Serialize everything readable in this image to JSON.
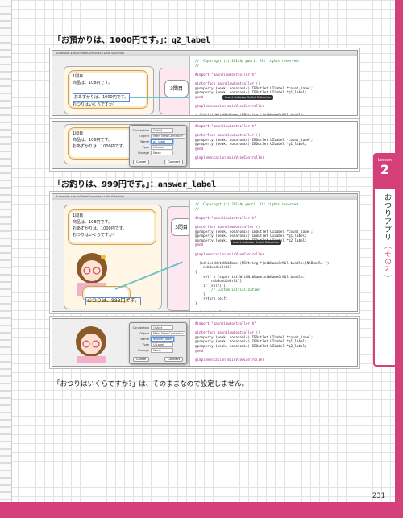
{
  "page": {
    "number": "231"
  },
  "headings": [
    {
      "prefix": "「お預かりは、1000円です。」：",
      "code": "q2_label"
    },
    {
      "prefix": "「お釣りは、999円です。」：",
      "code": "answer_label"
    }
  ],
  "caption": "「おつりはいくらですか?」は、そのままなので設定しません。",
  "side_tab": {
    "lesson": "Lesson",
    "number": "2",
    "title": "おつりアプリ",
    "subtitle": "（その2）"
  },
  "screens": {
    "toolbar_text": "Automatic  ▸  mainViewController.h  ▸  No Selection",
    "connection_badge": "Insert Outlet or Outlet Collection",
    "shot1": {
      "bubble_lines": [
        "1問目",
        "商品は、108円です。",
        "おあずかりは、1000円です。",
        "おつりはいくらですか?"
      ],
      "right_label": "3問目",
      "code": [
        {
          "t": "//  Copyright (c) 2014年 ymori. All rights reserved.",
          "c": "comment"
        },
        {
          "t": "//",
          "c": "comment"
        },
        {
          "t": "",
          "c": ""
        },
        {
          "t": "#import \"mainViewController.h\"",
          "c": "kw"
        },
        {
          "t": "",
          "c": ""
        },
        {
          "t": "@interface mainViewController ()",
          "c": "kw"
        },
        {
          "t": "@property (weak, nonatomic) IBOutlet UILabel *count_label;",
          "c": ""
        },
        {
          "t": "@property (weak, nonatomic) IBOutlet UILabel *q1_label;",
          "c": ""
        },
        {
          "t": "@end",
          "c": "kw"
        },
        {
          "t": "",
          "c": ""
        },
        {
          "t": "@implementation mainViewController",
          "c": "kw"
        },
        {
          "t": "",
          "c": ""
        },
        {
          "t": "- (id)initWithNibName:(NSString *)nibNameOrNil bundle:",
          "c": ""
        }
      ]
    },
    "dialog1": {
      "rows": [
        {
          "k": "Connection",
          "v": "Outlet"
        },
        {
          "k": "Object",
          "v": "Main View Controller"
        },
        {
          "k": "Name",
          "v": "q2_label"
        },
        {
          "k": "Type",
          "v": "UILabel"
        },
        {
          "k": "Storage",
          "v": "Weak"
        }
      ],
      "cancel": "Cancel",
      "connect": "Connect"
    },
    "shot2": {
      "bubble_lines": [
        "1問目",
        "商品は、108円です。",
        "おあずかりは、1000円です。"
      ],
      "code": [
        {
          "t": "#import \"mainViewController.h\"",
          "c": "kw"
        },
        {
          "t": "",
          "c": ""
        },
        {
          "t": "@interface mainViewController ()",
          "c": "kw"
        },
        {
          "t": "@property (weak, nonatomic) IBOutlet UILabel *count_label;",
          "c": ""
        },
        {
          "t": "@property (weak, nonatomic) IBOutlet UILabel *q1_label;",
          "c": ""
        },
        {
          "t": "@end",
          "c": "kw"
        },
        {
          "t": "",
          "c": ""
        },
        {
          "t": "@implementation mainViewController",
          "c": "kw"
        }
      ]
    },
    "shot3": {
      "bubble_lines": [
        "1問目",
        "商品は、108円です。",
        "おあずかりは、1000円です。",
        "おつりはいくらですか?"
      ],
      "answer_bubble": "おつりは、999円です。",
      "right_label": "3問目",
      "code": [
        {
          "t": "//  Copyright (c) 2014年 ymori. All rights reserved.",
          "c": "comment"
        },
        {
          "t": "//",
          "c": "comment"
        },
        {
          "t": "",
          "c": ""
        },
        {
          "t": "#import \"mainViewController.h\"",
          "c": "kw"
        },
        {
          "t": "",
          "c": ""
        },
        {
          "t": "@interface mainViewController ()",
          "c": "kw"
        },
        {
          "t": "@property (weak, nonatomic) IBOutlet UILabel *count_label;",
          "c": ""
        },
        {
          "t": "@property (weak, nonatomic) IBOutlet UILabel *q1_label;",
          "c": ""
        },
        {
          "t": "@property (weak, nonatomic) IBOutlet UILabel *q2_label;",
          "c": ""
        },
        {
          "t": "@end",
          "c": "kw"
        },
        {
          "t": "",
          "c": ""
        },
        {
          "t": "@implementation mainViewController",
          "c": "kw"
        },
        {
          "t": "",
          "c": ""
        },
        {
          "t": "- (id)initWithNibName:(NSString *)nibNameOrNil bundle:(NSBundle *)",
          "c": ""
        },
        {
          "t": "    nibBundleOrNil",
          "c": ""
        },
        {
          "t": "{",
          "c": ""
        },
        {
          "t": "    self = [super initWithNibName:nibNameOrNil bundle:",
          "c": ""
        },
        {
          "t": "        nibBundleOrNil];",
          "c": ""
        },
        {
          "t": "    if (self) {",
          "c": ""
        },
        {
          "t": "        // Custom initialization",
          "c": "comment"
        },
        {
          "t": "    }",
          "c": ""
        },
        {
          "t": "    return self;",
          "c": ""
        },
        {
          "t": "}",
          "c": ""
        },
        {
          "t": "",
          "c": ""
        },
        {
          "t": "- (void)viewDidLoad",
          "c": ""
        },
        {
          "t": "{",
          "c": ""
        },
        {
          "t": "    [super viewDidLoad];",
          "c": ""
        }
      ]
    },
    "dialog2": {
      "rows": [
        {
          "k": "Connection",
          "v": "Outlet"
        },
        {
          "k": "Object",
          "v": "Main View Controller"
        },
        {
          "k": "Name",
          "v": "answer_label"
        },
        {
          "k": "Type",
          "v": "UILabel"
        },
        {
          "k": "Storage",
          "v": "Weak"
        }
      ],
      "cancel": "Cancel",
      "connect": "Connect"
    },
    "shot4": {
      "code": [
        {
          "t": "#import \"mainViewController.h\"",
          "c": "kw"
        },
        {
          "t": "",
          "c": ""
        },
        {
          "t": "@interface mainViewController ()",
          "c": "kw"
        },
        {
          "t": "@property (weak, nonatomic) IBOutlet UILabel *count_label;",
          "c": ""
        },
        {
          "t": "@property (weak, nonatomic) IBOutlet UILabel *q1_label;",
          "c": ""
        },
        {
          "t": "@property (weak, nonatomic) IBOutlet UILabel *q2_label;",
          "c": ""
        },
        {
          "t": "@end",
          "c": "kw"
        },
        {
          "t": "",
          "c": ""
        },
        {
          "t": "@implementation mainViewController",
          "c": "kw"
        }
      ]
    }
  }
}
